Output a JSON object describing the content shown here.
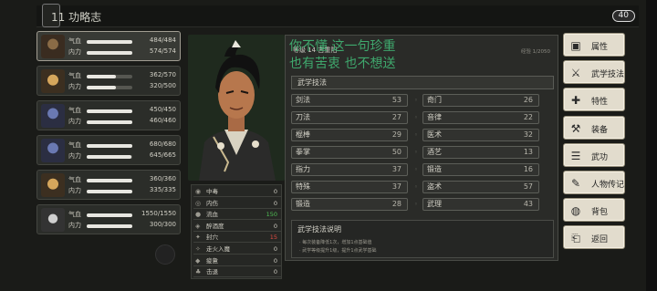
{
  "header": {
    "title": "功略志",
    "back_tab_label": "11",
    "counter": "40"
  },
  "party": [
    {
      "name": "member-1",
      "hp_label": "气血",
      "hp": "484/484",
      "hp_frac": 1.0,
      "mp_label": "内力",
      "mp": "574/574",
      "mp_frac": 1.0,
      "avatar": "hero-avatar"
    },
    {
      "name": "member-2",
      "hp_label": "气血",
      "hp": "362/570",
      "hp_frac": 0.64,
      "mp_label": "内力",
      "mp": "320/500",
      "mp_frac": 0.64,
      "avatar": "monk-avatar"
    },
    {
      "name": "member-3",
      "hp_label": "气血",
      "hp": "450/450",
      "hp_frac": 1.0,
      "mp_label": "内力",
      "mp": "460/460",
      "mp_frac": 1.0,
      "avatar": "blue-avatar"
    },
    {
      "name": "member-4",
      "hp_label": "气血",
      "hp": "680/680",
      "hp_frac": 1.0,
      "mp_label": "内力",
      "mp": "645/665",
      "mp_frac": 0.97,
      "avatar": "lady-avatar"
    },
    {
      "name": "member-5",
      "hp_label": "气血",
      "hp": "360/360",
      "hp_frac": 1.0,
      "mp_label": "内力",
      "mp": "335/335",
      "mp_frac": 1.0,
      "avatar": "fox-avatar"
    },
    {
      "name": "member-6",
      "hp_label": "气血",
      "hp": "1550/1550",
      "hp_frac": 1.0,
      "mp_label": "内力",
      "mp": "300/300",
      "mp_frac": 1.0,
      "avatar": "snake-avatar"
    }
  ],
  "character": {
    "level_text": "等级 14 古重阳",
    "exp_text": "经验 1/2050",
    "overlay_line1": "你不懂 这一句珍重",
    "overlay_line2": "也有苦衷 也不想送"
  },
  "skills_section": {
    "title": "武学技法"
  },
  "skills": [
    {
      "name": "剑法",
      "value": "53"
    },
    {
      "name": "奇门",
      "value": "26"
    },
    {
      "name": "刀法",
      "value": "27"
    },
    {
      "name": "音律",
      "value": "22"
    },
    {
      "name": "棍棒",
      "value": "29"
    },
    {
      "name": "医术",
      "value": "32"
    },
    {
      "name": "拳掌",
      "value": "50"
    },
    {
      "name": "酒艺",
      "value": "13"
    },
    {
      "name": "指力",
      "value": "37"
    },
    {
      "name": "锻造",
      "value": "16"
    },
    {
      "name": "特殊",
      "value": "37"
    },
    {
      "name": "盗术",
      "value": "57"
    },
    {
      "name": "锻造",
      "value": "28"
    },
    {
      "name": "武理",
      "value": "43"
    }
  ],
  "description": {
    "title": "武学技法说明",
    "line1": "· 每次装备降低1次，增加1点基础值",
    "line2": "· 武学等级提升1级，提升1点武学基础"
  },
  "status_effects": [
    {
      "icon": "poison-icon",
      "glyph": "◉",
      "name": "中毒",
      "value": "0",
      "tone": ""
    },
    {
      "icon": "internal-injury-icon",
      "glyph": "◎",
      "name": "内伤",
      "value": "0",
      "tone": ""
    },
    {
      "icon": "bleed-icon",
      "glyph": "●",
      "name": "流血",
      "value": "150",
      "tone": "g"
    },
    {
      "icon": "drunk-icon",
      "glyph": "◈",
      "name": "醉酒度",
      "value": "0",
      "tone": ""
    },
    {
      "icon": "seal-icon",
      "glyph": "✦",
      "name": "封穴",
      "value": "15",
      "tone": "r"
    },
    {
      "icon": "qi-deviation-icon",
      "glyph": "✧",
      "name": "走火入魔",
      "value": "0",
      "tone": ""
    },
    {
      "icon": "tired-icon",
      "glyph": "◆",
      "name": "疲惫",
      "value": "0",
      "tone": ""
    },
    {
      "icon": "hit-icon",
      "glyph": "♣",
      "name": "击退",
      "value": "0",
      "tone": ""
    }
  ],
  "menu": [
    {
      "icon": "attributes-icon",
      "glyph": "▣",
      "label": "属性"
    },
    {
      "icon": "martial-arts-icon",
      "glyph": "⚔",
      "label": "武学技法"
    },
    {
      "icon": "traits-icon",
      "glyph": "✚",
      "label": "特性"
    },
    {
      "icon": "equipment-icon",
      "glyph": "⚒",
      "label": "装备"
    },
    {
      "icon": "kungfu-icon",
      "glyph": "☰",
      "label": "武功"
    },
    {
      "icon": "biography-icon",
      "glyph": "✎",
      "label": "人物传记"
    },
    {
      "icon": "bag-icon",
      "glyph": "◍",
      "label": "背包"
    },
    {
      "icon": "return-icon",
      "glyph": "⎗",
      "label": "返回"
    }
  ]
}
